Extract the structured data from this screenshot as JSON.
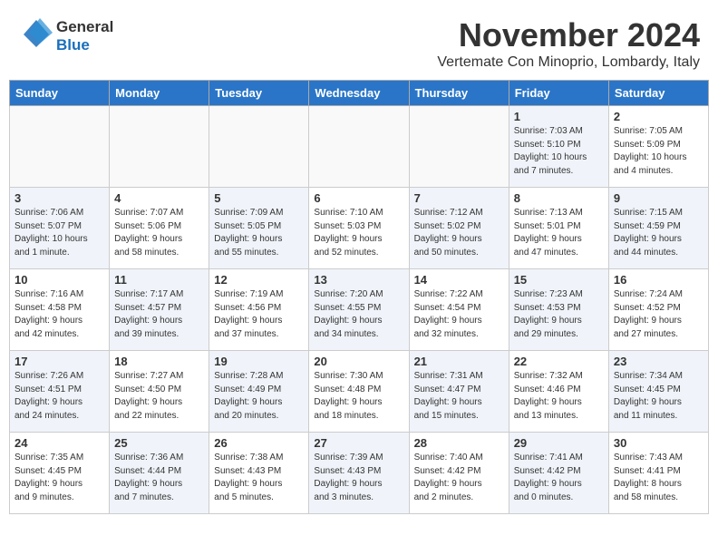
{
  "logo": {
    "line1": "General",
    "line2": "Blue"
  },
  "header": {
    "month": "November 2024",
    "location": "Vertemate Con Minoprio, Lombardy, Italy"
  },
  "weekdays": [
    "Sunday",
    "Monday",
    "Tuesday",
    "Wednesday",
    "Thursday",
    "Friday",
    "Saturday"
  ],
  "weeks": [
    [
      {
        "day": "",
        "info": "",
        "shaded": false
      },
      {
        "day": "",
        "info": "",
        "shaded": false
      },
      {
        "day": "",
        "info": "",
        "shaded": false
      },
      {
        "day": "",
        "info": "",
        "shaded": false
      },
      {
        "day": "",
        "info": "",
        "shaded": false
      },
      {
        "day": "1",
        "info": "Sunrise: 7:03 AM\nSunset: 5:10 PM\nDaylight: 10 hours\nand 7 minutes.",
        "shaded": true
      },
      {
        "day": "2",
        "info": "Sunrise: 7:05 AM\nSunset: 5:09 PM\nDaylight: 10 hours\nand 4 minutes.",
        "shaded": false
      }
    ],
    [
      {
        "day": "3",
        "info": "Sunrise: 7:06 AM\nSunset: 5:07 PM\nDaylight: 10 hours\nand 1 minute.",
        "shaded": true
      },
      {
        "day": "4",
        "info": "Sunrise: 7:07 AM\nSunset: 5:06 PM\nDaylight: 9 hours\nand 58 minutes.",
        "shaded": false
      },
      {
        "day": "5",
        "info": "Sunrise: 7:09 AM\nSunset: 5:05 PM\nDaylight: 9 hours\nand 55 minutes.",
        "shaded": true
      },
      {
        "day": "6",
        "info": "Sunrise: 7:10 AM\nSunset: 5:03 PM\nDaylight: 9 hours\nand 52 minutes.",
        "shaded": false
      },
      {
        "day": "7",
        "info": "Sunrise: 7:12 AM\nSunset: 5:02 PM\nDaylight: 9 hours\nand 50 minutes.",
        "shaded": true
      },
      {
        "day": "8",
        "info": "Sunrise: 7:13 AM\nSunset: 5:01 PM\nDaylight: 9 hours\nand 47 minutes.",
        "shaded": false
      },
      {
        "day": "9",
        "info": "Sunrise: 7:15 AM\nSunset: 4:59 PM\nDaylight: 9 hours\nand 44 minutes.",
        "shaded": true
      }
    ],
    [
      {
        "day": "10",
        "info": "Sunrise: 7:16 AM\nSunset: 4:58 PM\nDaylight: 9 hours\nand 42 minutes.",
        "shaded": false
      },
      {
        "day": "11",
        "info": "Sunrise: 7:17 AM\nSunset: 4:57 PM\nDaylight: 9 hours\nand 39 minutes.",
        "shaded": true
      },
      {
        "day": "12",
        "info": "Sunrise: 7:19 AM\nSunset: 4:56 PM\nDaylight: 9 hours\nand 37 minutes.",
        "shaded": false
      },
      {
        "day": "13",
        "info": "Sunrise: 7:20 AM\nSunset: 4:55 PM\nDaylight: 9 hours\nand 34 minutes.",
        "shaded": true
      },
      {
        "day": "14",
        "info": "Sunrise: 7:22 AM\nSunset: 4:54 PM\nDaylight: 9 hours\nand 32 minutes.",
        "shaded": false
      },
      {
        "day": "15",
        "info": "Sunrise: 7:23 AM\nSunset: 4:53 PM\nDaylight: 9 hours\nand 29 minutes.",
        "shaded": true
      },
      {
        "day": "16",
        "info": "Sunrise: 7:24 AM\nSunset: 4:52 PM\nDaylight: 9 hours\nand 27 minutes.",
        "shaded": false
      }
    ],
    [
      {
        "day": "17",
        "info": "Sunrise: 7:26 AM\nSunset: 4:51 PM\nDaylight: 9 hours\nand 24 minutes.",
        "shaded": true
      },
      {
        "day": "18",
        "info": "Sunrise: 7:27 AM\nSunset: 4:50 PM\nDaylight: 9 hours\nand 22 minutes.",
        "shaded": false
      },
      {
        "day": "19",
        "info": "Sunrise: 7:28 AM\nSunset: 4:49 PM\nDaylight: 9 hours\nand 20 minutes.",
        "shaded": true
      },
      {
        "day": "20",
        "info": "Sunrise: 7:30 AM\nSunset: 4:48 PM\nDaylight: 9 hours\nand 18 minutes.",
        "shaded": false
      },
      {
        "day": "21",
        "info": "Sunrise: 7:31 AM\nSunset: 4:47 PM\nDaylight: 9 hours\nand 15 minutes.",
        "shaded": true
      },
      {
        "day": "22",
        "info": "Sunrise: 7:32 AM\nSunset: 4:46 PM\nDaylight: 9 hours\nand 13 minutes.",
        "shaded": false
      },
      {
        "day": "23",
        "info": "Sunrise: 7:34 AM\nSunset: 4:45 PM\nDaylight: 9 hours\nand 11 minutes.",
        "shaded": true
      }
    ],
    [
      {
        "day": "24",
        "info": "Sunrise: 7:35 AM\nSunset: 4:45 PM\nDaylight: 9 hours\nand 9 minutes.",
        "shaded": false
      },
      {
        "day": "25",
        "info": "Sunrise: 7:36 AM\nSunset: 4:44 PM\nDaylight: 9 hours\nand 7 minutes.",
        "shaded": true
      },
      {
        "day": "26",
        "info": "Sunrise: 7:38 AM\nSunset: 4:43 PM\nDaylight: 9 hours\nand 5 minutes.",
        "shaded": false
      },
      {
        "day": "27",
        "info": "Sunrise: 7:39 AM\nSunset: 4:43 PM\nDaylight: 9 hours\nand 3 minutes.",
        "shaded": true
      },
      {
        "day": "28",
        "info": "Sunrise: 7:40 AM\nSunset: 4:42 PM\nDaylight: 9 hours\nand 2 minutes.",
        "shaded": false
      },
      {
        "day": "29",
        "info": "Sunrise: 7:41 AM\nSunset: 4:42 PM\nDaylight: 9 hours\nand 0 minutes.",
        "shaded": true
      },
      {
        "day": "30",
        "info": "Sunrise: 7:43 AM\nSunset: 4:41 PM\nDaylight: 8 hours\nand 58 minutes.",
        "shaded": false
      }
    ]
  ]
}
